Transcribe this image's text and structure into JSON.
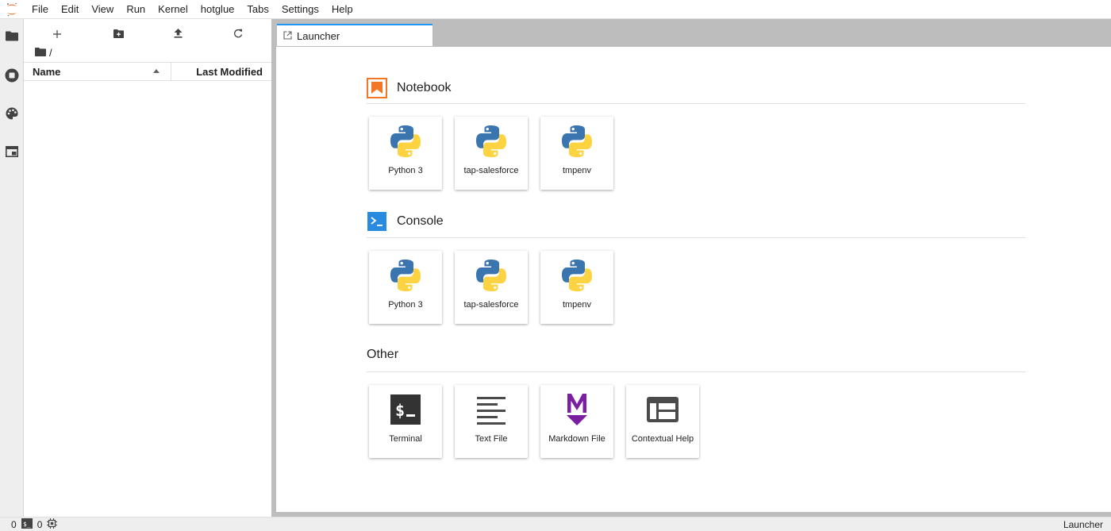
{
  "menu": [
    "File",
    "Edit",
    "View",
    "Run",
    "Kernel",
    "hotglue",
    "Tabs",
    "Settings",
    "Help"
  ],
  "activity_icons": [
    "folder-icon",
    "running-icon",
    "palette-icon",
    "tabs-icon"
  ],
  "filebrowser": {
    "breadcrumb": "/",
    "columns": {
      "name": "Name",
      "modified": "Last Modified"
    }
  },
  "tab": {
    "label": "Launcher"
  },
  "launcher": {
    "notebook": {
      "title": "Notebook",
      "items": [
        "Python 3",
        "tap-salesforce",
        "tmpenv"
      ]
    },
    "console": {
      "title": "Console",
      "items": [
        "Python 3",
        "tap-salesforce",
        "tmpenv"
      ]
    },
    "other": {
      "title": "Other",
      "items": [
        "Terminal",
        "Text File",
        "Markdown File",
        "Contextual Help"
      ]
    }
  },
  "status": {
    "kernels": "0",
    "terminals": "0",
    "mode": "Launcher"
  },
  "colors": {
    "accent": "#2196f3",
    "notebook_icon": "#f37626",
    "console_icon": "#288be0",
    "markdown_icon": "#7b1fa2",
    "terminal_icon": "#333333"
  }
}
